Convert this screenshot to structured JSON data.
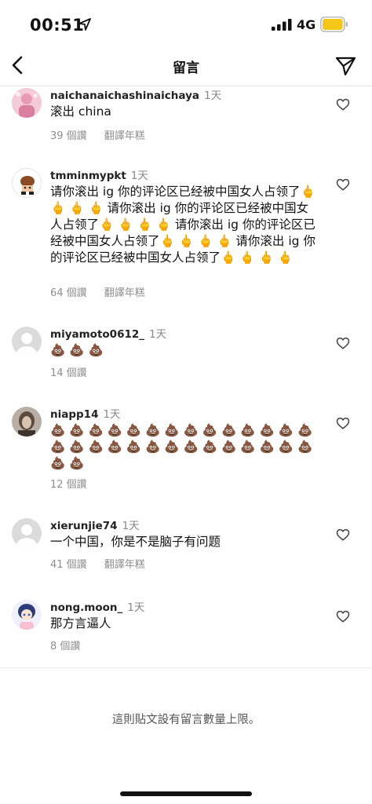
{
  "status": {
    "time": "00:51",
    "network": "4G"
  },
  "nav": {
    "title": "留言"
  },
  "comments": [
    {
      "username": "naichanaichashinaichaya",
      "time": "1天",
      "text": "滚出 china",
      "likes": "39 個讚",
      "translate": "翻譯年糕"
    },
    {
      "username": "tmminmypkt",
      "time": "1天",
      "text": "请你滚出 ig 你的评论区已经被中国女人占领了🖕 🖕 🖕 🖕 请你滚出 ig 你的评论区已经被中国女人占领了🖕 🖕 🖕 🖕 请你滚出 ig 你的评论区已经被中国女人占领了🖕 🖕 🖕 🖕 请你滚出 ig 你的评论区已经被中国女人占领了🖕 🖕 🖕 🖕",
      "likes": "64 個讚",
      "translate": "翻譯年糕"
    },
    {
      "username": "miyamoto0612_",
      "time": "1天",
      "text": "💩 💩 💩",
      "likes": "14 個讚",
      "translate": ""
    },
    {
      "username": "niapp14",
      "time": "1天",
      "text": "💩 💩 💩 💩 💩 💩 💩 💩 💩 💩 💩 💩 💩 💩 💩 💩 💩 💩 💩 💩 💩 💩 💩 💩 💩 💩 💩 💩 💩 💩",
      "likes": "12 個讚",
      "translate": ""
    },
    {
      "username": "xierunjie74",
      "time": "1天",
      "text": "一个中国，你是不是脑子有问题",
      "likes": "41 個讚",
      "translate": "翻譯年糕"
    },
    {
      "username": "nong.moon_",
      "time": "1天",
      "text": "那方言逼人",
      "likes": "8 個讚",
      "translate": ""
    }
  ],
  "footer": {
    "note": "這則貼文設有留言數量上限。"
  },
  "colors": {
    "accent_battery": "#f5c518",
    "muted": "#8e8e8e"
  }
}
